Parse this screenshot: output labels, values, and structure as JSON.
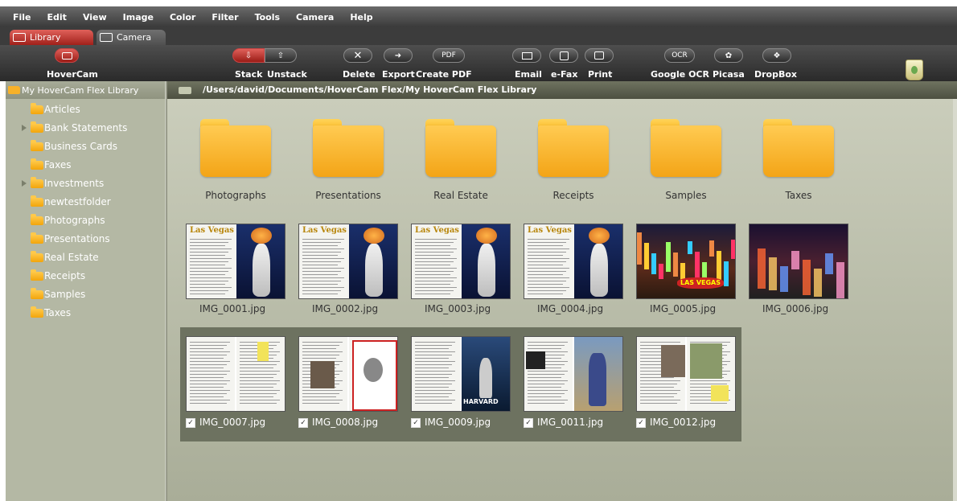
{
  "menu": [
    "File",
    "Edit",
    "View",
    "Image",
    "Color",
    "Filter",
    "Tools",
    "Camera",
    "Help"
  ],
  "tabs": {
    "library": "Library",
    "camera": "Camera"
  },
  "toolbar": {
    "hovercam": "HoverCam",
    "stack": "Stack",
    "unstack": "Unstack",
    "delete": "Delete",
    "export": "Export",
    "create_pdf": "Create PDF",
    "pdf_icon": "PDF",
    "email": "Email",
    "efax": "e-Fax",
    "print": "Print",
    "google_ocr": "Google OCR",
    "ocr_icon": "OCR",
    "picasa": "Picasa",
    "dropbox": "DropBox"
  },
  "sidebar": {
    "root": "My HoverCam Flex Library",
    "items": [
      {
        "label": "Articles",
        "expandable": false
      },
      {
        "label": "Bank Statements",
        "expandable": true
      },
      {
        "label": "Business Cards",
        "expandable": false
      },
      {
        "label": "Faxes",
        "expandable": false
      },
      {
        "label": "Investments",
        "expandable": true
      },
      {
        "label": "newtestfolder",
        "expandable": false
      },
      {
        "label": "Photographs",
        "expandable": false
      },
      {
        "label": "Presentations",
        "expandable": false
      },
      {
        "label": "Real Estate",
        "expandable": false
      },
      {
        "label": "Receipts",
        "expandable": false
      },
      {
        "label": "Samples",
        "expandable": false
      },
      {
        "label": "Taxes",
        "expandable": false
      }
    ]
  },
  "path": "/Users/david/Documents/HoverCam Flex/My HoverCam Flex Library",
  "folders": [
    "Photographs",
    "Presentations",
    "Real Estate",
    "Receipts",
    "Samples",
    "Taxes"
  ],
  "images_row1": [
    "IMG_0001.jpg",
    "IMG_0002.jpg",
    "IMG_0003.jpg",
    "IMG_0004.jpg",
    "IMG_0005.jpg",
    "IMG_0006.jpg"
  ],
  "images_row2": [
    "IMG_0007.jpg",
    "IMG_0008.jpg",
    "IMG_0009.jpg",
    "IMG_0011.jpg",
    "IMG_0012.jpg"
  ],
  "thumb_text": {
    "las_vegas": "LAS VEGAS",
    "las_vegas_title": "Las Vegas",
    "harvard": "HARVARD"
  },
  "checkbox_mark": "✓",
  "colors": {
    "accent_red": "#c0302a",
    "folder": "#f7b129",
    "panel": "#b4b8a4"
  }
}
